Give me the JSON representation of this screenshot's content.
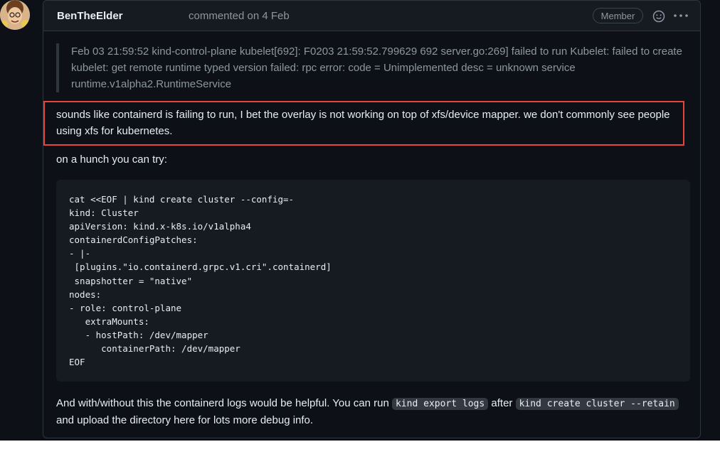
{
  "comment": {
    "author": "BenTheElder",
    "meta": "commented on 4 Feb",
    "badge": "Member",
    "quote": "Feb 03 21:59:52 kind-control-plane kubelet[692]: F0203 21:59:52.799629 692 server.go:269] failed to run Kubelet: failed to create kubelet: get remote runtime typed version failed: rpc error: code = Unimplemented desc = unknown service runtime.v1alpha2.RuntimeService",
    "highlighted_paragraph": "sounds like containerd is failing to run, I bet the overlay is not working on top of xfs/device mapper. we don't commonly see people using xfs for kubernetes.",
    "hunch_paragraph": "on a hunch you can try:",
    "code": "cat <<EOF | kind create cluster --config=-\nkind: Cluster\napiVersion: kind.x-k8s.io/v1alpha4\ncontainerdConfigPatches:\n- |-\n [plugins.\"io.containerd.grpc.v1.cri\".containerd]\n snapshotter = \"native\"\nnodes:\n- role: control-plane\n   extraMounts:\n   - hostPath: /dev/mapper\n      containerPath: /dev/mapper\nEOF",
    "final_paragraph": {
      "part1": "And with/without this the containerd logs would be helpful. You can run ",
      "code1": "kind export logs",
      "part2": " after ",
      "code2": "kind create cluster --retain",
      "part3": " and upload the directory here for lots more debug info."
    }
  },
  "icons": {
    "avatar": "avatar-icon",
    "emoji": "smiley-icon",
    "more": "kebab-horizontal-icon"
  },
  "colors": {
    "highlight_border": "#e5453b",
    "background": "#0d1117"
  }
}
